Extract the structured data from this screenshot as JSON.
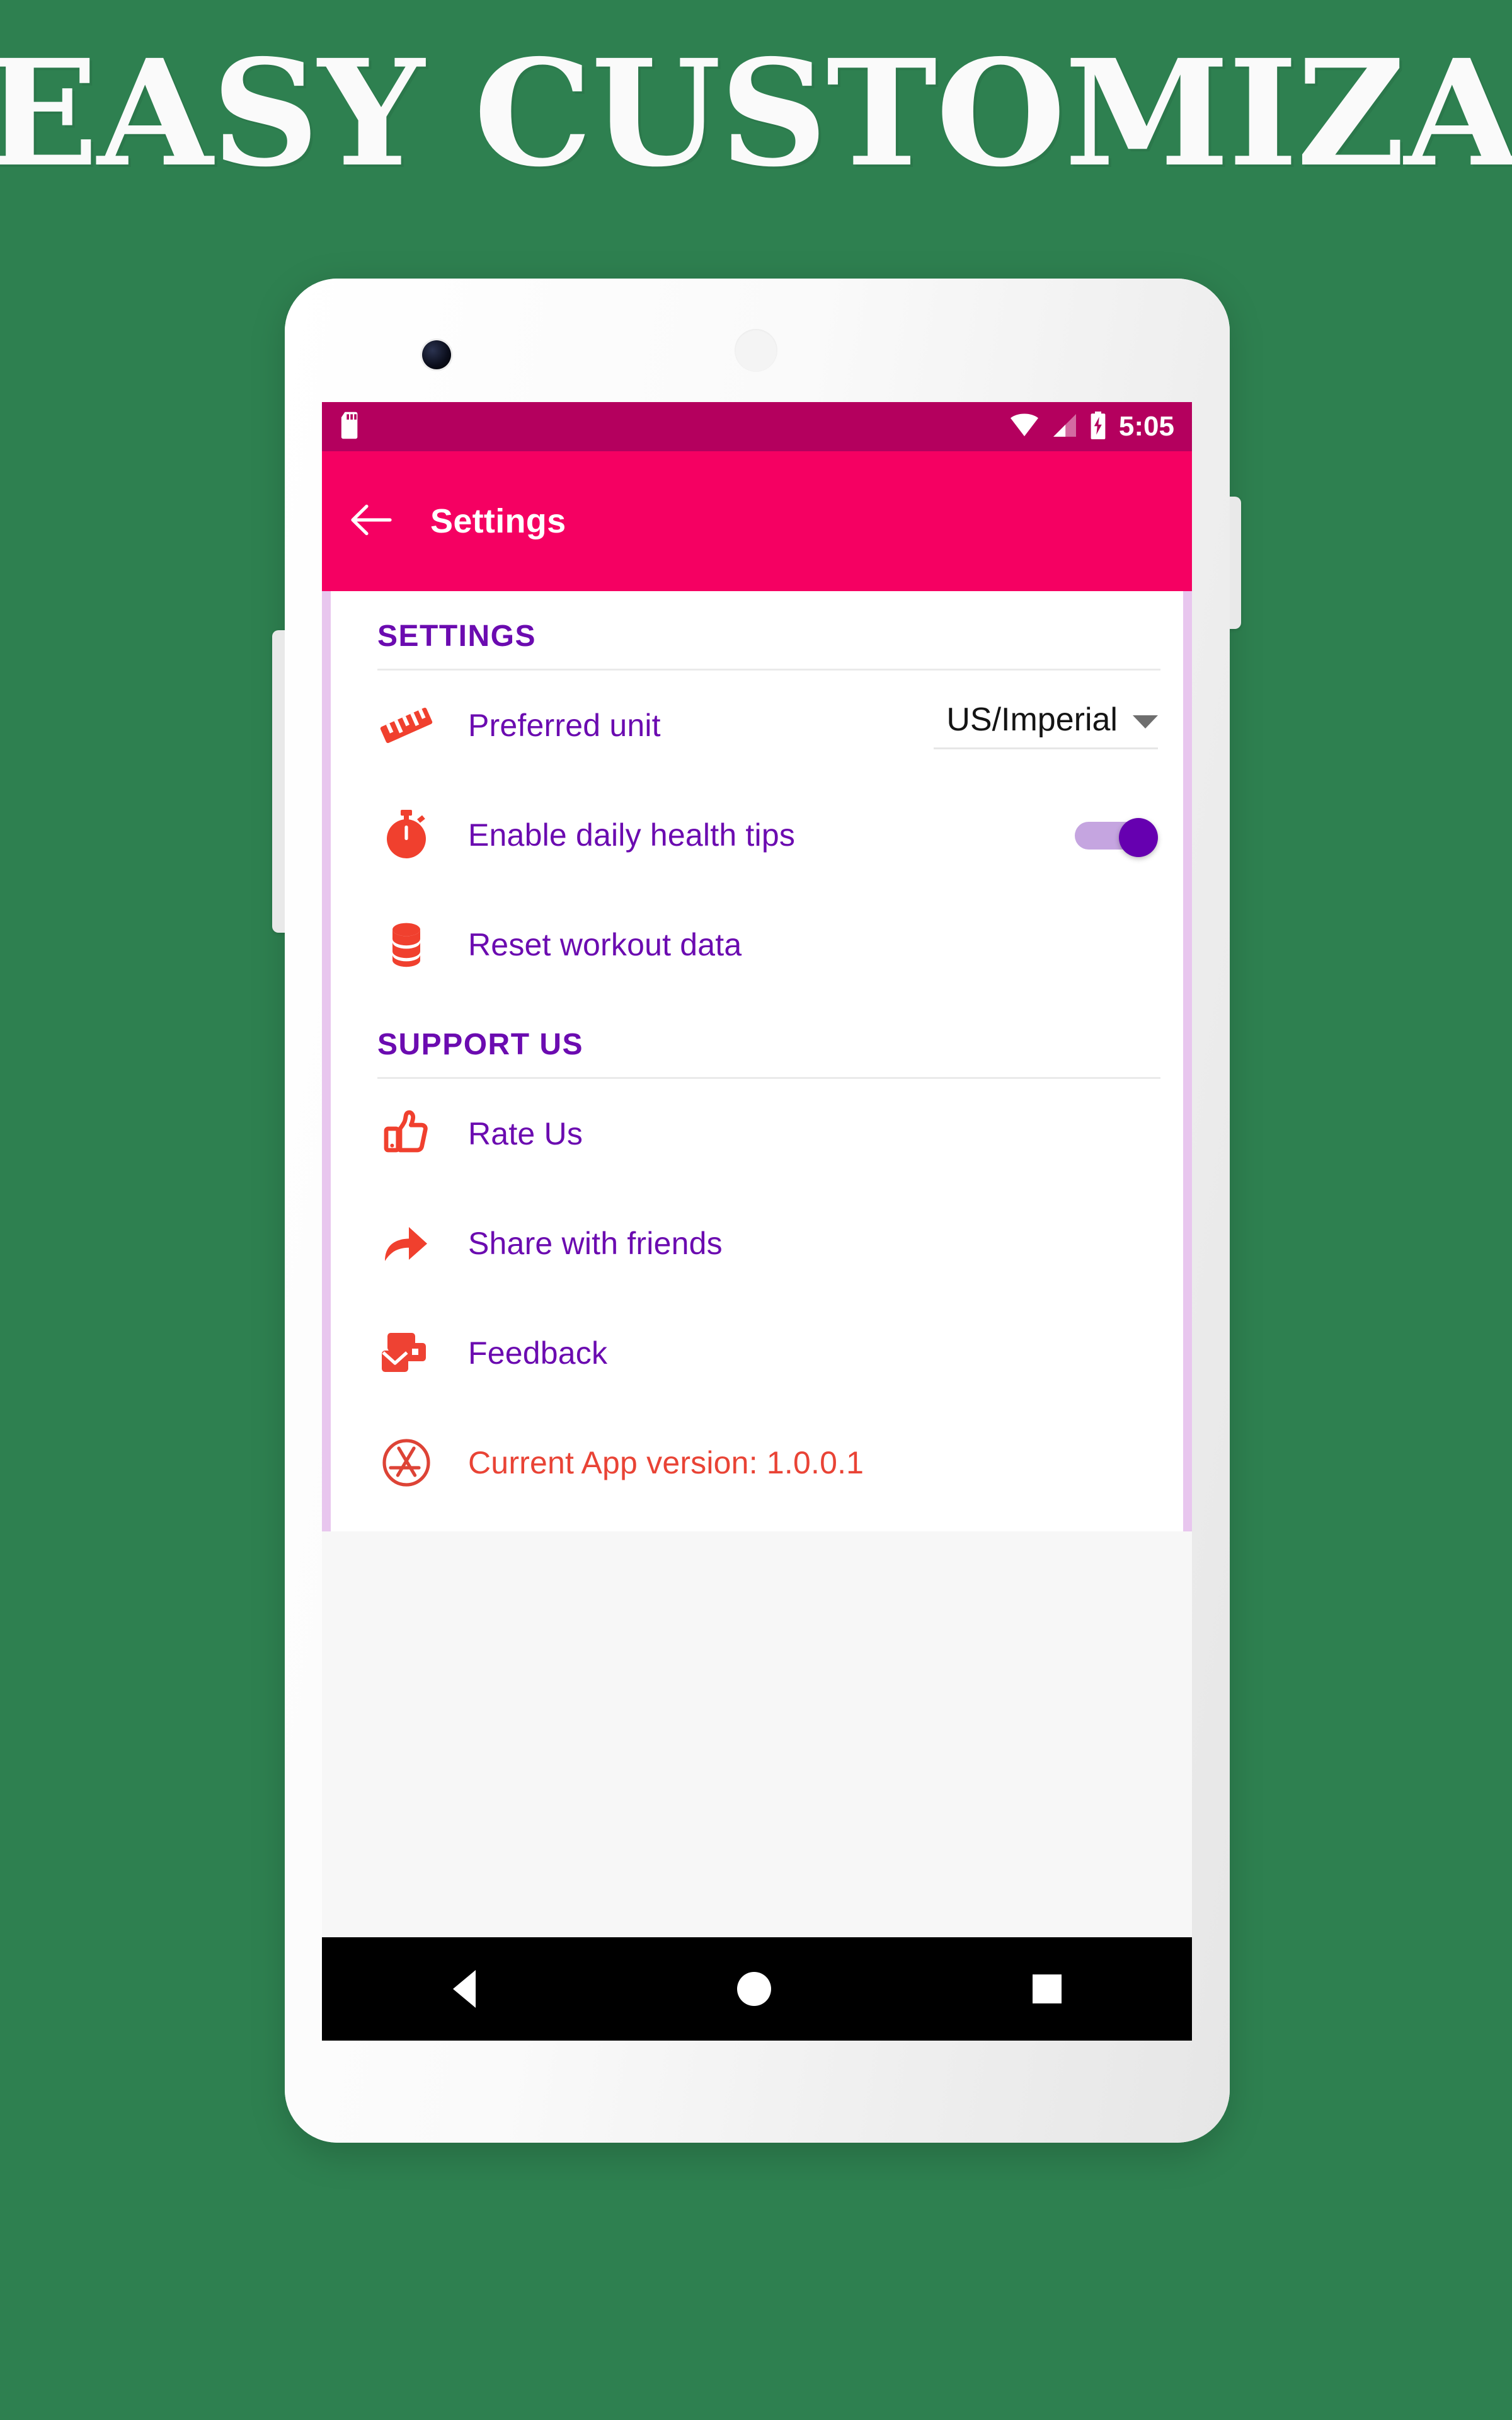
{
  "promo": {
    "headline": "EASY CUSTOMIZATION",
    "background_color": "#2E8050",
    "headline_color": "#FAFAFA"
  },
  "phone": {
    "camera_icon": "camera-lens-icon",
    "speaker_icon": "earpiece-speaker-icon",
    "left_button": "volume-button",
    "right_button": "power-button"
  },
  "status_bar": {
    "background_color": "#B4005E",
    "sd_card_icon": "sd-card-icon",
    "wifi_icon": "wifi-icon",
    "signal_icon": "cellular-signal-icon",
    "battery_icon": "battery-charging-icon",
    "time": "5:05"
  },
  "app_bar": {
    "background_color": "#F50062",
    "back_icon": "arrow-left-icon",
    "title": "Settings"
  },
  "sections": [
    {
      "id": "settings",
      "header": "SETTINGS",
      "header_color": "#6B0BB0",
      "rows": [
        {
          "id": "preferred-unit",
          "icon": "ruler-icon",
          "label": "Preferred unit",
          "control": "dropdown",
          "value": "US/Imperial",
          "caret_icon": "caret-down-icon"
        },
        {
          "id": "daily-health-tips",
          "icon": "stopwatch-icon",
          "label": "Enable daily health tips",
          "control": "toggle",
          "value": "on",
          "track_color": "#C5A5E0",
          "thumb_color": "#6600B0"
        },
        {
          "id": "reset-workout-data",
          "icon": "database-icon",
          "label": "Reset workout data",
          "control": "none"
        }
      ]
    },
    {
      "id": "support-us",
      "header": "SUPPORT US",
      "header_color": "#6B0BB0",
      "rows": [
        {
          "id": "rate-us",
          "icon": "thumbs-up-icon",
          "label": "Rate Us",
          "control": "none"
        },
        {
          "id": "share-with-friends",
          "icon": "share-arrow-icon",
          "label": "Share with friends",
          "control": "none"
        },
        {
          "id": "feedback",
          "icon": "feedback-mail-icon",
          "label": "Feedback",
          "control": "none"
        },
        {
          "id": "app-version",
          "icon": "app-store-icon",
          "label": "Current App version: 1.0.0.1",
          "label_color": "#E94335",
          "control": "none"
        }
      ]
    }
  ],
  "nav_bar": {
    "background_color": "#000000",
    "back_icon": "nav-back-triangle-icon",
    "home_icon": "nav-home-circle-icon",
    "recents_icon": "nav-recents-square-icon"
  }
}
